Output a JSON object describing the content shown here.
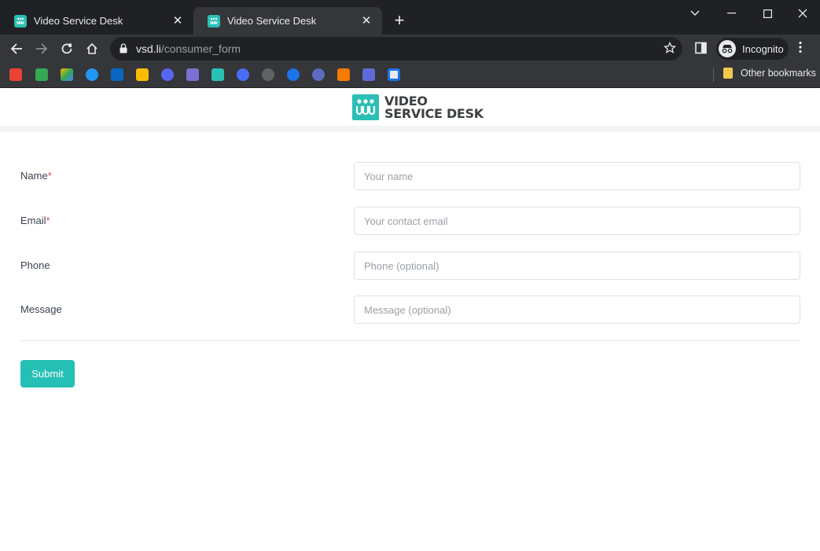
{
  "browser": {
    "tabs": [
      {
        "title": "Video Service Desk",
        "active": false
      },
      {
        "title": "Video Service Desk",
        "active": true
      }
    ],
    "url": {
      "host": "vsd.li",
      "path": "/consumer_form"
    },
    "profile_label": "Incognito",
    "other_bookmarks_label": "Other bookmarks",
    "bookmark_icons": [
      "gmail-icon",
      "google-chat-icon",
      "google-drive-icon",
      "tasks-icon",
      "linkedin-icon",
      "keep-icon",
      "discord-icon",
      "app-icon",
      "video-service-desk-icon",
      "canva-icon",
      "github-icon",
      "sync-icon",
      "clockify-icon",
      "box-icon",
      "miro-icon",
      "focus-icon"
    ],
    "colors": {
      "titlebar": "#202124",
      "toolbar": "#35363a",
      "brand": "#2bbfb5"
    }
  },
  "page": {
    "logo": {
      "line1": "VIDEO",
      "line2": "SERVICE DESK"
    },
    "form": {
      "fields": [
        {
          "label": "Name",
          "required": true,
          "placeholder": "Your name"
        },
        {
          "label": "Email",
          "required": true,
          "placeholder": "Your contact email"
        },
        {
          "label": "Phone",
          "required": false,
          "placeholder": "Phone (optional)"
        },
        {
          "label": "Message",
          "required": false,
          "placeholder": "Message (optional)"
        }
      ],
      "required_marker": "*",
      "submit_label": "Submit"
    }
  }
}
